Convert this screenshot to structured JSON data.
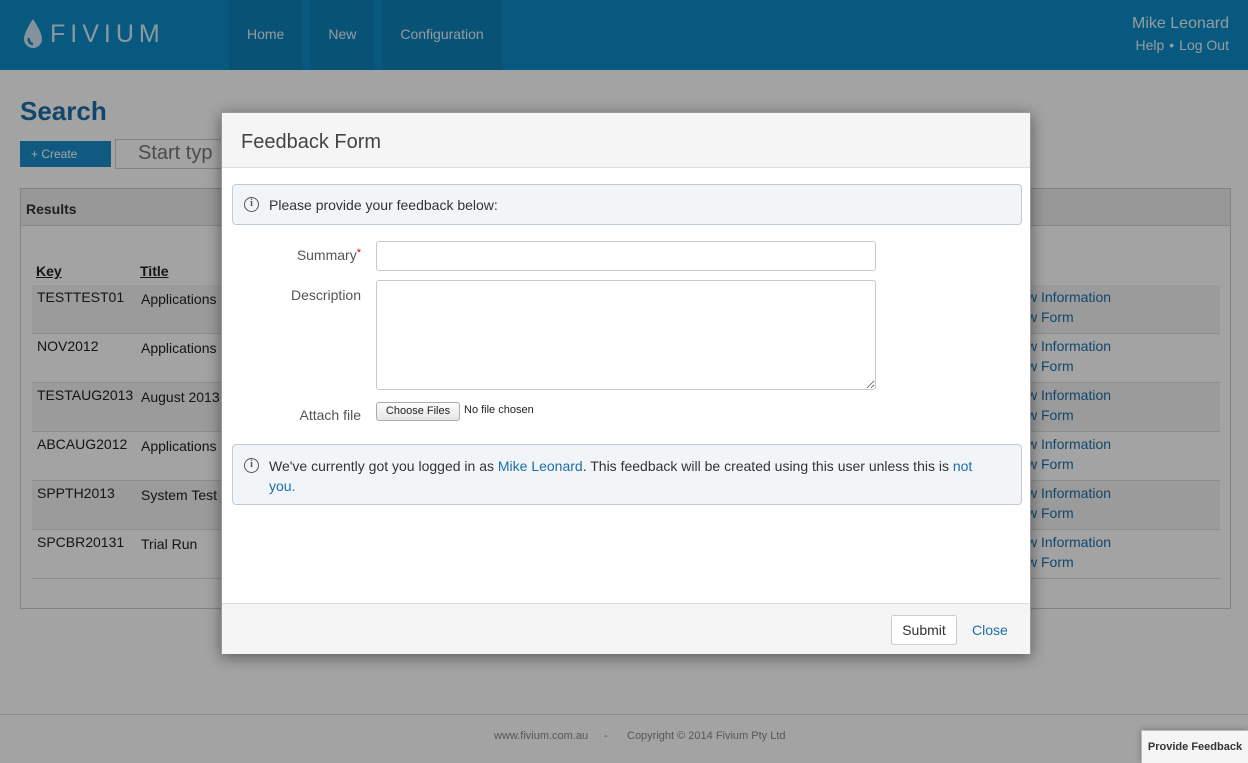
{
  "brand": {
    "name": "FIVIUM"
  },
  "nav": {
    "items": [
      "Home",
      "New",
      "Configuration"
    ]
  },
  "user": {
    "name": "Mike Leonard",
    "help": "Help",
    "separator": "•",
    "logout": "Log Out"
  },
  "search": {
    "title": "Search",
    "create_label": "+ Create",
    "placeholder": "Start typ"
  },
  "results": {
    "heading": "Results",
    "columns": [
      "Key",
      "Title"
    ],
    "rows": [
      {
        "key": "TESTTEST01",
        "title": "Applications",
        "link1": "w Information",
        "link2": "w Form"
      },
      {
        "key": "NOV2012",
        "title": "Applications",
        "link1": "w Information",
        "link2": "w Form"
      },
      {
        "key": "TESTAUG2013",
        "title": "August 2013",
        "link1": "w Information",
        "link2": "w Form"
      },
      {
        "key": "ABCAUG2012",
        "title": "Applications",
        "link1": "w Information",
        "link2": "w Form"
      },
      {
        "key": "SPPTH2013",
        "title": "System Test",
        "link1": "w Information",
        "link2": "w Form"
      },
      {
        "key": "SPCBR20131",
        "title": "Trial Run",
        "link1": "w Information",
        "link2": "w Form"
      }
    ]
  },
  "footer": {
    "site": "www.fivium.com.au",
    "separator": "-",
    "copyright": "Copyright © 2014 Fivium Pty Ltd"
  },
  "feedback_tab": {
    "label": "Provide Feedback"
  },
  "modal": {
    "title": "Feedback Form",
    "intro": "Please provide your feedback below:",
    "summary_label": "Summary",
    "required_mark": "*",
    "description_label": "Description",
    "attach_label": "Attach file",
    "choose_button": "Choose Files",
    "no_file": "No file chosen",
    "notice_prefix": "We've currently got you logged in as ",
    "notice_user": "Mike Leonard",
    "notice_middle": ". This feedback will be created using this user unless this is ",
    "notice_link": "not you.",
    "submit_label": "Submit",
    "close_label": "Close"
  },
  "colors": {
    "header_blue": "#0e8cc7",
    "link_blue": "#1d6ea8",
    "required_red": "#dd0000"
  },
  "icons": {
    "logo": "water-drop-icon",
    "info": "info-circle-icon",
    "resize": "resize-grip-icon"
  }
}
